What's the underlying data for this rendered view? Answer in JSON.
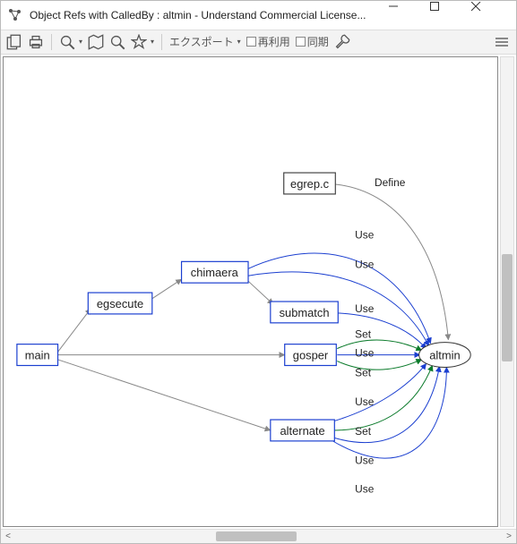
{
  "window": {
    "title": "Object Refs with CalledBy : altmin - Understand Commercial License..."
  },
  "toolbar": {
    "export_label": "エクスポート",
    "reuse_label": "再利用",
    "sync_label": "同期"
  },
  "graph": {
    "nodes": {
      "egrep_c": "egrep.c",
      "chimaera": "chimaera",
      "egsecute": "egsecute",
      "submatch": "submatch",
      "main": "main",
      "gosper": "gosper",
      "alternate": "alternate",
      "altmin": "altmin"
    },
    "edge_labels": {
      "define": "Define",
      "use1": "Use",
      "use2": "Use",
      "use3": "Use",
      "set1": "Set",
      "use4": "Use",
      "set2": "Set",
      "use5": "Use",
      "set3": "Set",
      "use6": "Use",
      "use7": "Use"
    }
  }
}
